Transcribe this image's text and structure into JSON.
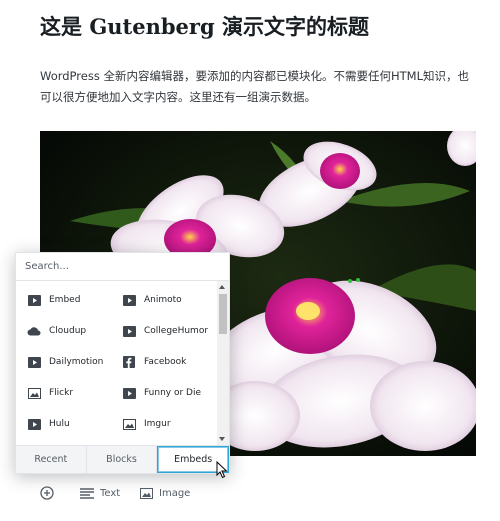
{
  "post": {
    "title_prefix": "这是",
    "title_brand": "Gutenberg",
    "title_suffix": "演示文字的标题",
    "paragraph": "WordPress 全新内容编辑器，要添加的内容都已模块化。不需要任何HTML知识，也可以很方便地加入文字内容。这里还有一组演示数据。"
  },
  "inserter": {
    "search_placeholder": "Search...",
    "items": [
      {
        "label": "Embed",
        "icon": "video-embed-icon"
      },
      {
        "label": "Animoto",
        "icon": "video-embed-icon"
      },
      {
        "label": "Cloudup",
        "icon": "cloud-icon"
      },
      {
        "label": "CollegeHumor",
        "icon": "video-embed-icon"
      },
      {
        "label": "Dailymotion",
        "icon": "video-embed-icon"
      },
      {
        "label": "Facebook",
        "icon": "facebook-icon"
      },
      {
        "label": "Flickr",
        "icon": "image-icon"
      },
      {
        "label": "Funny or Die",
        "icon": "video-embed-icon"
      },
      {
        "label": "Hulu",
        "icon": "video-embed-icon"
      },
      {
        "label": "Imgur",
        "icon": "image-icon"
      }
    ],
    "tabs": [
      {
        "label": "Recent"
      },
      {
        "label": "Blocks"
      },
      {
        "label": "Embeds",
        "active": true
      }
    ]
  },
  "toolbar": {
    "text_label": "Text",
    "image_label": "Image"
  },
  "colors": {
    "accent": "#2fa6d8",
    "text": "#23282d",
    "muted": "#555d66"
  }
}
